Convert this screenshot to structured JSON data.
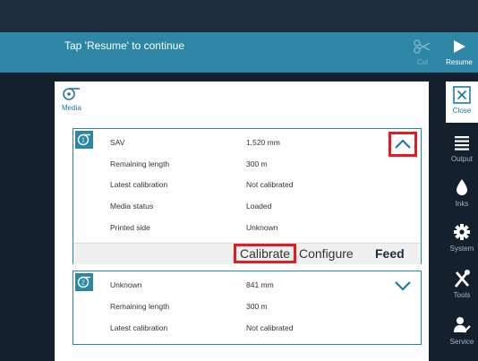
{
  "header": {
    "message": "Tap 'Resume' to continue",
    "cut_label": "Cut",
    "resume_label": "Resume"
  },
  "panel": {
    "title": "Media",
    "cards": [
      {
        "number": "1",
        "expanded": true,
        "rows": [
          {
            "label": "SAV",
            "value": "1,520 mm"
          },
          {
            "label": "Remaining length",
            "value": "300 m"
          },
          {
            "label": "Latest calibration",
            "value": "Not calibrated"
          },
          {
            "label": "Media status",
            "value": "Loaded"
          },
          {
            "label": "Printed side",
            "value": "Unknown"
          }
        ],
        "actions": {
          "calibrate": "Calibrate",
          "configure": "Configure",
          "feed": "Feed"
        }
      },
      {
        "number": "2",
        "expanded": false,
        "rows": [
          {
            "label": "Unknown",
            "value": "841 mm"
          },
          {
            "label": "Remaining length",
            "value": "300 m"
          },
          {
            "label": "Latest calibration",
            "value": "Not calibrated"
          }
        ]
      }
    ]
  },
  "sidebar": {
    "items": [
      {
        "label": "Close",
        "icon": "close-icon"
      },
      {
        "label": "Output",
        "icon": "output-icon"
      },
      {
        "label": "Inks",
        "icon": "ink-drop-icon"
      },
      {
        "label": "System",
        "icon": "gear-icon"
      },
      {
        "label": "Tools",
        "icon": "tools-icon"
      },
      {
        "label": "Service",
        "icon": "service-icon"
      }
    ]
  },
  "colors": {
    "accent": "#2e86a6",
    "dark": "#14202d",
    "highlight": "#e21c22"
  }
}
